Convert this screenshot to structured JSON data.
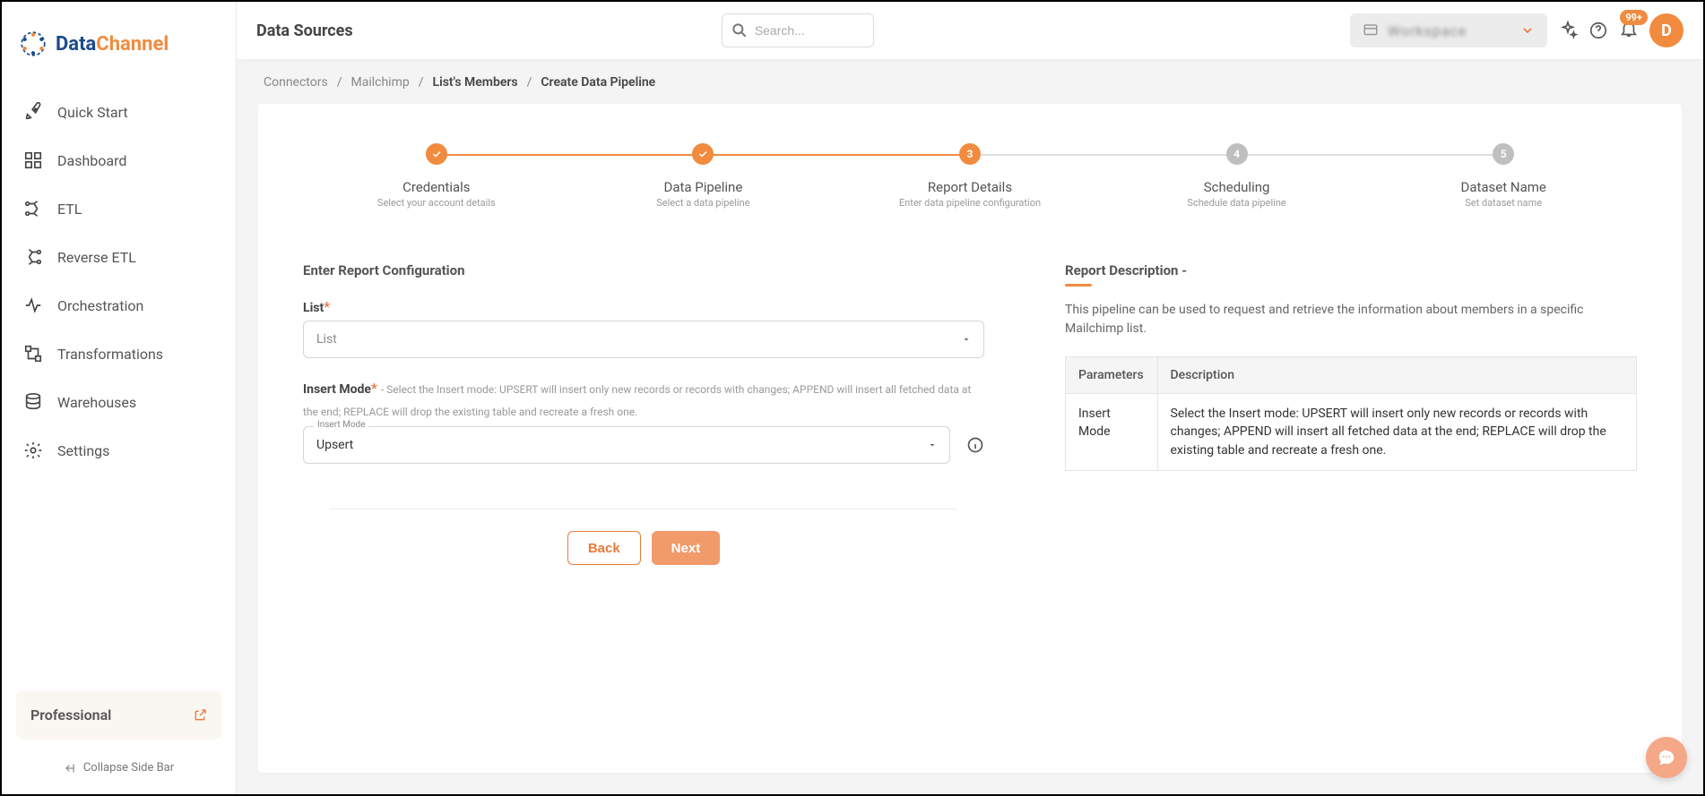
{
  "logo": {
    "brand_a": "Data",
    "brand_b": "Channel"
  },
  "sidebar": {
    "items": [
      {
        "label": "Quick Start"
      },
      {
        "label": "Dashboard"
      },
      {
        "label": "ETL"
      },
      {
        "label": "Reverse ETL"
      },
      {
        "label": "Orchestration"
      },
      {
        "label": "Transformations"
      },
      {
        "label": "Warehouses"
      },
      {
        "label": "Settings"
      }
    ],
    "plan_label": "Professional",
    "collapse_label": "Collapse Side Bar"
  },
  "topbar": {
    "title": "Data Sources",
    "search_placeholder": "Search...",
    "workspace_label": "Workspace",
    "badge": "99+",
    "avatar_initial": "D"
  },
  "breadcrumb": {
    "items": [
      "Connectors",
      "Mailchimp",
      "List's Members",
      "Create Data Pipeline"
    ],
    "active_index": [
      2,
      3
    ]
  },
  "stepper": [
    {
      "title": "Credentials",
      "sub": "Select your account details",
      "state": "done"
    },
    {
      "title": "Data Pipeline",
      "sub": "Select a data pipeline",
      "state": "done"
    },
    {
      "title": "Report Details",
      "sub": "Enter data pipeline configuration",
      "state": "current",
      "num": "3"
    },
    {
      "title": "Scheduling",
      "sub": "Schedule data pipeline",
      "state": "pending",
      "num": "4"
    },
    {
      "title": "Dataset Name",
      "sub": "Set dataset name",
      "state": "pending",
      "num": "5"
    }
  ],
  "form": {
    "section_title": "Enter Report Configuration",
    "list_label": "List",
    "list_placeholder": "List",
    "mode_label": "Insert Mode",
    "mode_help": "- Select the Insert mode: UPSERT will insert only new records or records with changes; APPEND will insert all fetched data at the end; REPLACE will drop the existing table and recreate a fresh one.",
    "mode_floating": "Insert Mode",
    "mode_value": "Upsert",
    "back_label": "Back",
    "next_label": "Next"
  },
  "desc": {
    "title": "Report Description -",
    "text": "This pipeline can be used to request and retrieve the information about members in a specific Mailchimp list.",
    "table": {
      "headers": [
        "Parameters",
        "Description"
      ],
      "rows": [
        {
          "param": "Insert Mode",
          "description": "Select the Insert mode: UPSERT will insert only new records or records with changes; APPEND will insert all fetched data at the end; REPLACE will drop the existing table and recreate a fresh one."
        }
      ]
    }
  }
}
